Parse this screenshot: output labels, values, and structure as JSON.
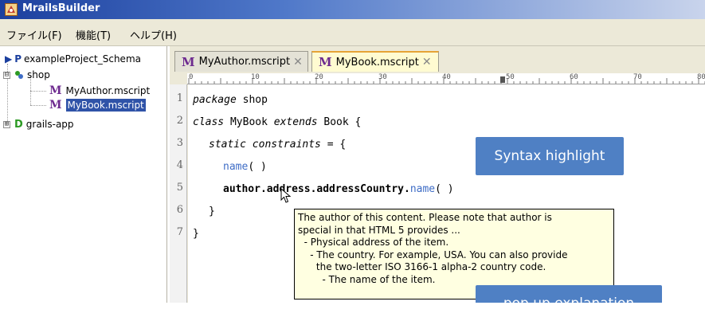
{
  "window": {
    "title": "MrailsBuilder",
    "icon": "app-icon"
  },
  "menu": {
    "items": [
      "ファイル(F)",
      "機能(T)",
      "ヘルプ(H)"
    ]
  },
  "tree": {
    "root": {
      "prefix": "P",
      "label": "exampleProject_Schema"
    },
    "package": {
      "label": "shop",
      "expander": "⊟"
    },
    "files": [
      {
        "label": "MyAuthor.mscript",
        "icon": "M"
      },
      {
        "label": "MyBook.mscript",
        "icon": "M",
        "selected": true
      }
    ],
    "app": {
      "label": "grails-app",
      "icon": "D",
      "expander": "⊞"
    }
  },
  "tabs": [
    {
      "label": "MyAuthor.mscript",
      "icon": "M",
      "close": "✕",
      "active": false
    },
    {
      "label": "MyBook.mscript",
      "icon": "M",
      "close": "✕",
      "active": true
    }
  ],
  "ruler": {
    "marks": [
      "0",
      "10",
      "20",
      "30",
      "40",
      "50",
      "60",
      "70",
      "80"
    ]
  },
  "code": {
    "line_numbers": [
      "1",
      "2",
      "3",
      "4",
      "5",
      "6",
      "7"
    ],
    "lines": [
      {
        "kw": "package",
        "rest": " shop"
      },
      {
        "kw": "class",
        "rest1": " MyBook ",
        "kw2": "extends",
        "rest2": " Book {"
      },
      {
        "kw": "static constraints",
        "rest": " = {"
      },
      {
        "fn": "name",
        "rest": "( )"
      },
      {
        "bold": "author.address.addressCountry.",
        "fn": "name",
        "rest": "( )"
      },
      {
        "rest": "}"
      },
      {
        "rest": "}"
      }
    ]
  },
  "tooltip": {
    "lines": [
      "The author of this content. Please note that author is",
      "special in that HTML 5 provides ...",
      "  - Physical address of the item.",
      "    - The country. For example, USA. You can also provide",
      "      the two-letter ISO 3166-1 alpha-2 country code.",
      "        - The name of the item."
    ]
  },
  "callouts": {
    "syntax": "Syntax highlight",
    "popup": "pop up explanation"
  }
}
